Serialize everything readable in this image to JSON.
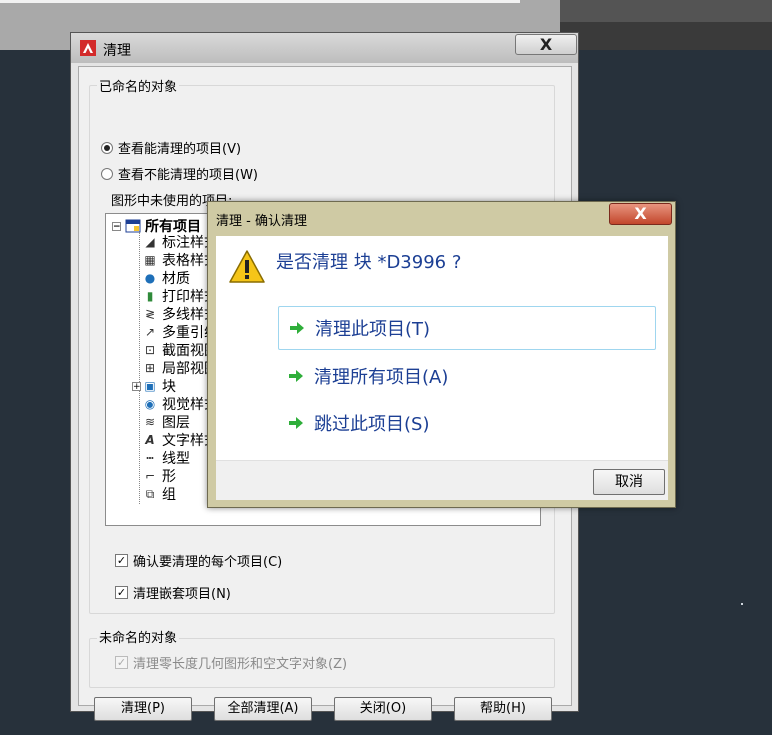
{
  "main_dialog": {
    "title": "清理",
    "close_glyph": "X",
    "named_group": {
      "legend": "已命名的对象",
      "radio_purgeable": "查看能清理的项目(V)",
      "radio_nonpurgeable": "查看不能清理的项目(W)",
      "tree_label": "图形中未使用的项目:",
      "tree_root": "所有项目",
      "tree_items": [
        {
          "label": "标注样式",
          "icon": "dimension-style-icon"
        },
        {
          "label": "表格样式",
          "icon": "table-style-icon"
        },
        {
          "label": "材质",
          "icon": "material-sphere-icon"
        },
        {
          "label": "打印样式",
          "icon": "plot-style-icon"
        },
        {
          "label": "多线样式",
          "icon": "multiline-style-icon"
        },
        {
          "label": "多重引线",
          "icon": "multileader-icon"
        },
        {
          "label": "截面视图",
          "icon": "section-view-icon"
        },
        {
          "label": "局部视图",
          "icon": "detail-view-icon"
        },
        {
          "label": "块",
          "icon": "block-icon"
        },
        {
          "label": "视觉样式",
          "icon": "visual-style-icon"
        },
        {
          "label": "图层",
          "icon": "layers-icon"
        },
        {
          "label": "文字样式",
          "icon": "text-style-icon"
        },
        {
          "label": "线型",
          "icon": "linetype-icon"
        },
        {
          "label": "形",
          "icon": "shape-icon"
        },
        {
          "label": "组",
          "icon": "group-icon"
        }
      ],
      "check_confirm": "确认要清理的每个项目(C)",
      "check_nested": "清理嵌套项目(N)"
    },
    "unnamed_group": {
      "legend": "未命名的对象",
      "check_zero_length": "清理零长度几何图形和空文字对象(Z)"
    },
    "buttons": {
      "purge": "清理(P)",
      "purge_all": "全部清理(A)",
      "close": "关闭(O)",
      "help": "帮助(H)"
    }
  },
  "confirm_dialog": {
    "title": "清理 - 确认清理",
    "close_glyph": "X",
    "question": "是否清理 块 *D3996 ?",
    "options": {
      "purge_item": "清理此项目(T)",
      "purge_all": "清理所有项目(A)",
      "skip_item": "跳过此项目(S)"
    },
    "cancel": "取消"
  },
  "colors": {
    "accent_blue": "#1c3f94",
    "arrow_green": "#2fae3a",
    "autocad_red": "#d32a2a"
  }
}
